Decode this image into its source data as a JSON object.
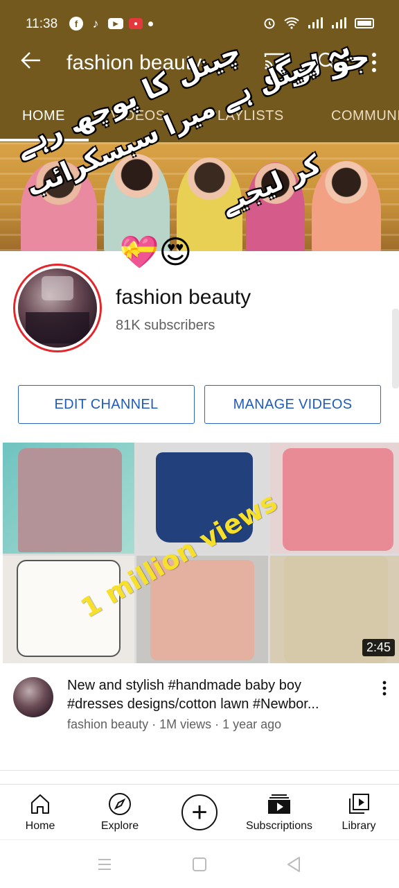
{
  "status_bar": {
    "time": "11:38",
    "app_icons": [
      "facebook-icon",
      "tiktok-icon",
      "youtube-icon",
      "screen-record-icon"
    ],
    "right_icons": [
      "alarm-icon",
      "wifi-icon",
      "signal-icon",
      "signal-icon",
      "battery-icon"
    ]
  },
  "app_bar": {
    "title": "fashion beauty",
    "icons": [
      "back-arrow-icon",
      "cast-icon",
      "search-icon",
      "more-vertical-icon"
    ]
  },
  "tabs": [
    {
      "label": "HOME",
      "active": true
    },
    {
      "label": "VIDEOS",
      "active": false
    },
    {
      "label": "PLAYLISTS",
      "active": false
    },
    {
      "label": "COMMUNITY",
      "active": false
    }
  ],
  "overlay_text": {
    "line1": "جو لوگ",
    "line2": "چینل کا پوچھ رہے",
    "line3": "یہ چینل ہے میرا سبسکرائب",
    "line4": "کر لیجیے",
    "emojis": "💝😍"
  },
  "channel": {
    "name": "fashion beauty",
    "subscribers": "81K subscribers",
    "edit_label": "EDIT CHANNEL",
    "manage_label": "MANAGE VIDEOS"
  },
  "video": {
    "overlay_caption": "1 million views",
    "duration": "2:45",
    "title_line1": "New and stylish #handmade baby boy",
    "title_line2": "#dresses designs/cotton lawn #Newbor...",
    "meta": "fashion beauty · 1M views · 1 year ago"
  },
  "bottom_nav": [
    {
      "label": "Home",
      "icon": "home-icon"
    },
    {
      "label": "Explore",
      "icon": "compass-icon"
    },
    {
      "label": "",
      "icon": "create-plus-icon"
    },
    {
      "label": "Subscriptions",
      "icon": "subscriptions-icon"
    },
    {
      "label": "Library",
      "icon": "library-icon"
    }
  ],
  "colors": {
    "header_bg": "#74591e",
    "accent_blue": "#1d5bbf",
    "avatar_ring": "#e3262b",
    "caption_yellow": "#f7e02b"
  }
}
